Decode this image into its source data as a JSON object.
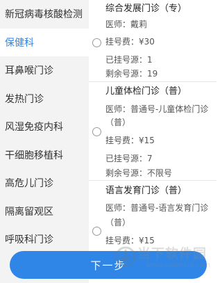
{
  "departments": [
    {
      "label": "新冠病毒核酸检测"
    },
    {
      "label": "保健科",
      "active": true
    },
    {
      "label": "耳鼻喉门诊"
    },
    {
      "label": "发热门诊"
    },
    {
      "label": "风湿免疫内科"
    },
    {
      "label": "干细胞移植科"
    },
    {
      "label": "高危儿门诊"
    },
    {
      "label": "隔离留观区"
    },
    {
      "label": "呼吸科门诊"
    }
  ],
  "clinics": [
    {
      "name": "综合发展门诊（专）",
      "doctor_line1": "医师：戴莉",
      "doctor_line2": "",
      "fee": "挂号费：¥30",
      "registered": "已挂号源：1",
      "remaining": "剩余号源：19"
    },
    {
      "name": "儿童体检门诊（普）",
      "doctor_line1": "医师：普通号-儿童体检门诊",
      "doctor_line2": "（普）",
      "fee": "挂号费：¥15",
      "registered": "已挂号源：7",
      "remaining": "剩余号源：不限号"
    },
    {
      "name": "语言发育门诊（普）",
      "doctor_line1": "医师：普通号-语言发育门诊",
      "doctor_line2": "（普）",
      "fee": "挂号费：¥15",
      "registered": "",
      "remaining": ""
    }
  ],
  "next_button": {
    "label": "下一步"
  },
  "watermark": {
    "title": "当下软件园",
    "url": "www.downxia.com"
  },
  "colors": {
    "accent": "#2f86e6",
    "sidebar_bg": "#f3f3f3",
    "active_text": "#2f86e6"
  },
  "icons": {
    "radio": "radio-unselected-icon",
    "watermark_logo": "arrow-logo-icon"
  }
}
